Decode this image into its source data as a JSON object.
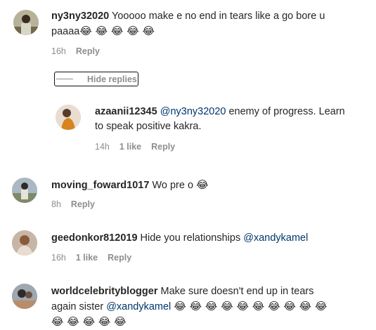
{
  "comments": [
    {
      "username": "ny3ny32020",
      "text": "Yooooo make e no end in tears like a go bore u",
      "text_line2": "paaaa",
      "emojis": "😂 😂 😂 😂 😂",
      "time": "16h",
      "reply_label": "Reply"
    },
    {
      "username": "azaanii12345",
      "mention": "@ny3ny32020",
      "text": "enemy of progress. Learn",
      "text_line2": "to speak positive kakra.",
      "time": "14h",
      "likes": "1 like",
      "reply_label": "Reply"
    },
    {
      "username": "moving_foward1017",
      "text": "Wo pre o",
      "emojis": "😂",
      "time": "8h",
      "reply_label": "Reply"
    },
    {
      "username": "geedonkor812019",
      "text": "Hide you relationships",
      "mention": "@xandykamel",
      "time": "16h",
      "likes": "1 like",
      "reply_label": "Reply"
    },
    {
      "username": "worldcelebrityblogger",
      "text": "Make sure doesn't end up in tears",
      "text_line2": "again sister",
      "mention": "@xandykamel",
      "emojis": "😂 😂 😂 😂 😂 😂 😂 😂 😂 😂",
      "emojis_line3": "😂 😂 😂 😂 😂"
    }
  ],
  "hide_replies_label": "Hide replies",
  "colors": {
    "mention": "#00376b",
    "meta": "#8e8e8e",
    "text": "#262626"
  }
}
